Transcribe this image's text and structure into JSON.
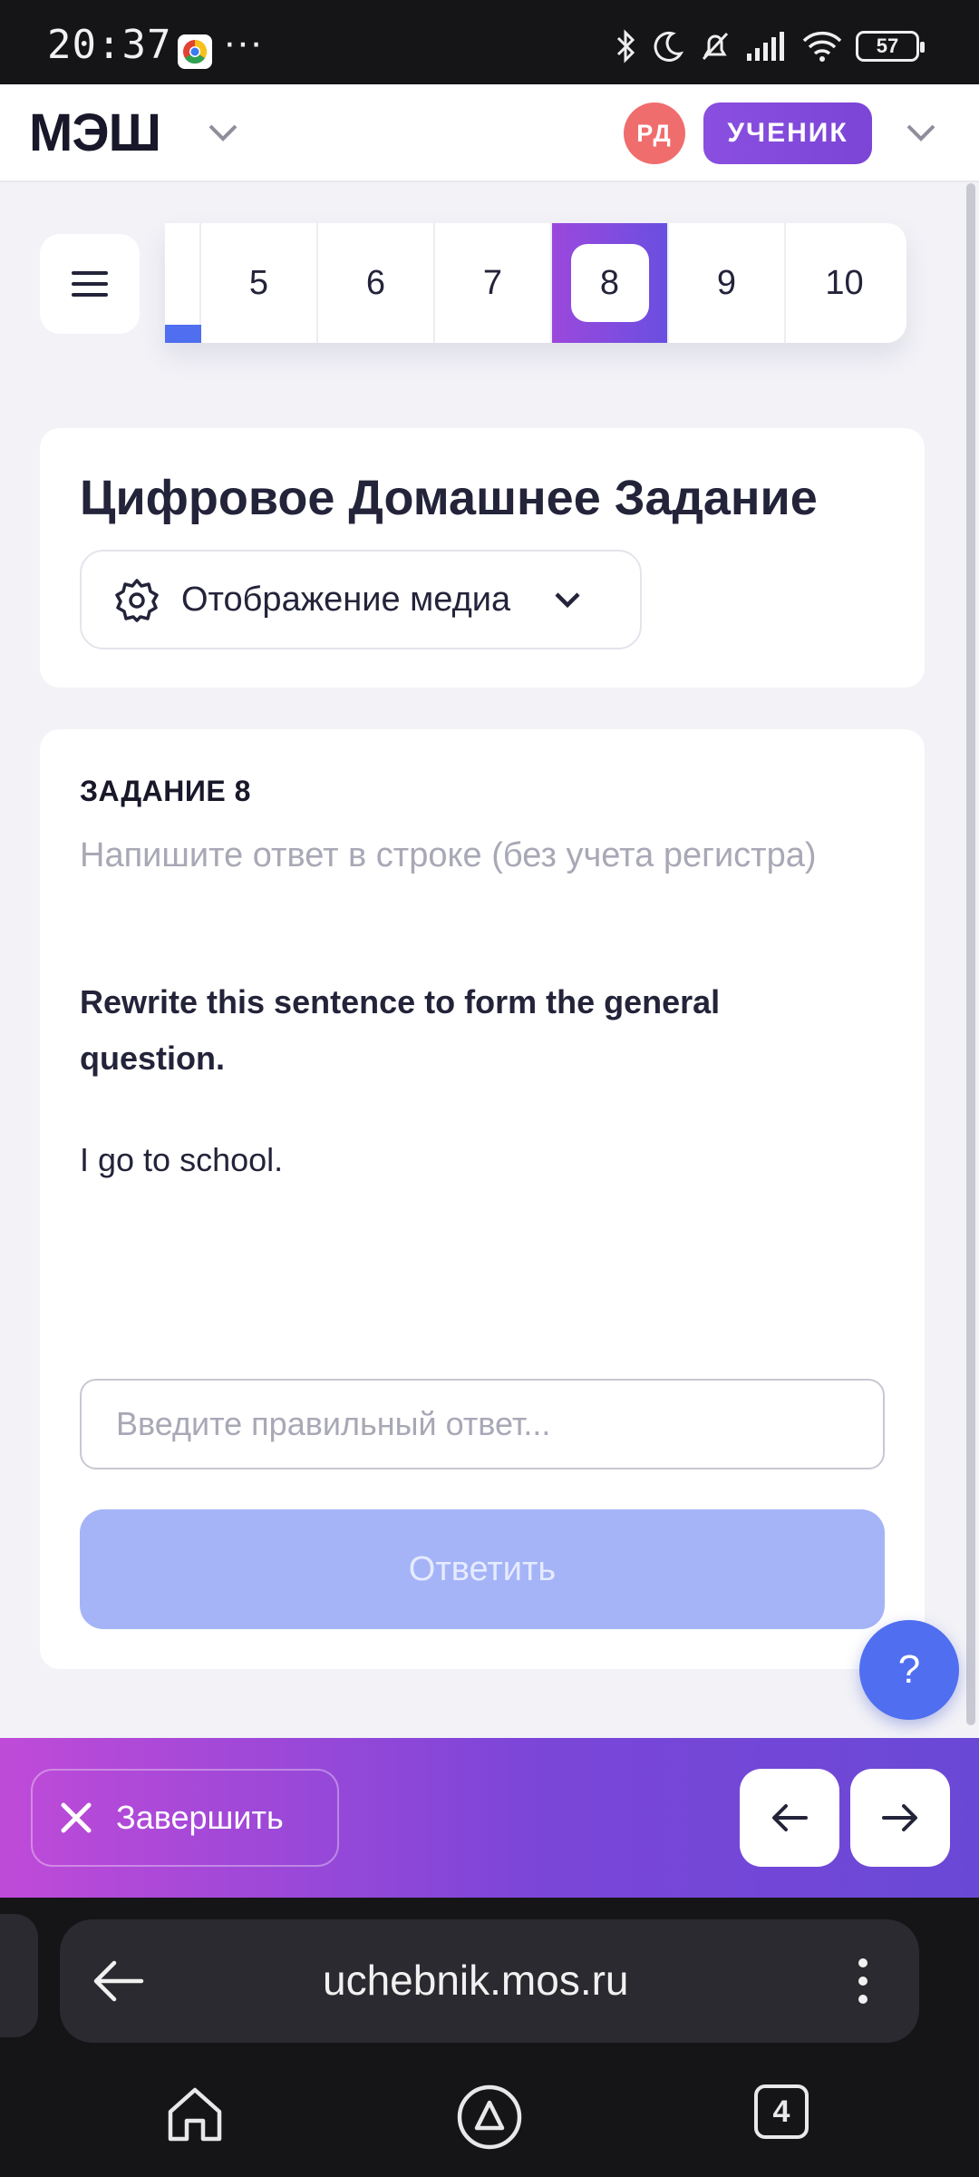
{
  "status_bar": {
    "time": "20:37",
    "dots": "···",
    "battery": "57"
  },
  "header": {
    "logo": "МЭШ",
    "avatar_initials": "РД",
    "role_label": "УЧЕНИК"
  },
  "question_nav": {
    "items": [
      "5",
      "6",
      "7",
      "8",
      "9",
      "10"
    ],
    "active": "8"
  },
  "title_card": {
    "title": "Цифровое Домашнее Задание",
    "media_label": "Отображение медиа"
  },
  "task": {
    "number_label": "ЗАДАНИЕ 8",
    "hint": "Напишите ответ в строке (без учета регистра)",
    "instruction": "Rewrite this sentence to form the general question.",
    "sentence": "I go to school.",
    "answer_value": "",
    "answer_placeholder": "Введите правильный ответ...",
    "submit_label": "Ответить"
  },
  "help": {
    "label": "?"
  },
  "action_bar": {
    "finish_label": "Завершить"
  },
  "browser": {
    "url": "uchebnik.mos.ru",
    "tab_count": "4"
  },
  "colors": {
    "accent_purple": "#8a4fe0",
    "accent_blue": "#4f6ef0",
    "avatar_red": "#f06d6d",
    "submit_disabled": "#a5b4f7"
  }
}
